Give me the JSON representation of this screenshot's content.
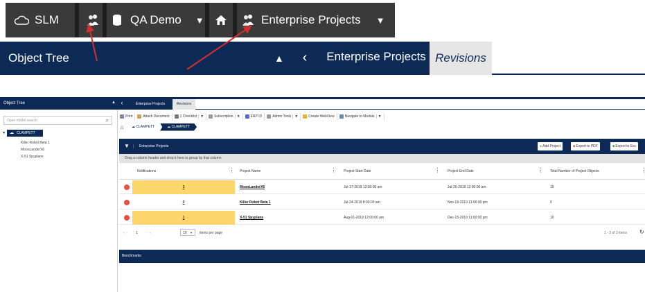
{
  "zoom": {
    "nav": {
      "slm_label": "SLM",
      "repository": "QA Demo",
      "module": "Enterprise Projects"
    },
    "panel_title": "Object Tree",
    "tabs": [
      {
        "label": "Enterprise Projects",
        "active": true
      },
      {
        "label": "Revisions",
        "active": false
      }
    ]
  },
  "sidebar": {
    "title": "Object Tree",
    "search_placeholder": "Open model search",
    "root": "CLAMPETT",
    "children": [
      "Killer Robot Beta 1",
      "MoonLanderX6",
      "X-51 Spyplane"
    ]
  },
  "main": {
    "tabs": [
      {
        "label": "Enterprise Projects",
        "active": true
      },
      {
        "label": "Revisions",
        "active": false
      }
    ],
    "toolbar": [
      {
        "label": "Print",
        "dropdown": false
      },
      {
        "label": "Attach Document",
        "dropdown": false
      },
      {
        "label": "1 Checklist",
        "dropdown": true
      },
      {
        "label": "Subscription",
        "dropdown": true
      },
      {
        "label": "ERP ID",
        "dropdown": false
      },
      {
        "label": "Admin Tools",
        "dropdown": true
      },
      {
        "label": "Create WebView",
        "dropdown": false
      },
      {
        "label": "Navigate to Module",
        "dropdown": true
      }
    ],
    "breadcrumb": [
      "CLAMPETT",
      "CLAMPETT"
    ],
    "grid": {
      "title": "Enterprise Projects",
      "buttons": [
        "Add Project",
        "Export to PDF",
        "Export to Exc"
      ],
      "group_hint": "Drag a column header and drop it here to group by that column",
      "columns": [
        "Notifications",
        "Project Name",
        "Project Start Date",
        "Project End Date",
        "Total Number of Project Objects"
      ],
      "rows": [
        {
          "notifications": "3",
          "name": "MoonLanderX6",
          "start": "Jul-17-2019 12:00:00 am",
          "end": "Jul-26-2019 12:00:00 am",
          "total": "19",
          "highlight": true
        },
        {
          "notifications": "0",
          "name": "Killer Robot Beta 1",
          "start": "Jul-24-2019 8:00:00 am",
          "end": "Nov-19-2019 11:00:00 pm",
          "total": "0",
          "highlight": false
        },
        {
          "notifications": "1",
          "name": "X-51 Spyplane",
          "start": "Aug-01-2019 12:00:00 am",
          "end": "Dec-15-2019 11:00:00 pm",
          "total": "10",
          "highlight": true
        }
      ],
      "pager": {
        "current_page": "1",
        "page_size": "10",
        "items_per_page_label": "items per page",
        "info": "1 - 3 of 3 items"
      }
    },
    "benchmarks_title": "Benchmarks"
  },
  "colors": {
    "navy": "#0c2a55",
    "dark_bar": "#3a3a3a",
    "highlight_yellow": "#fcd56b",
    "delete_red": "#e8513f",
    "annotation_arrow": "#d42e2e"
  }
}
